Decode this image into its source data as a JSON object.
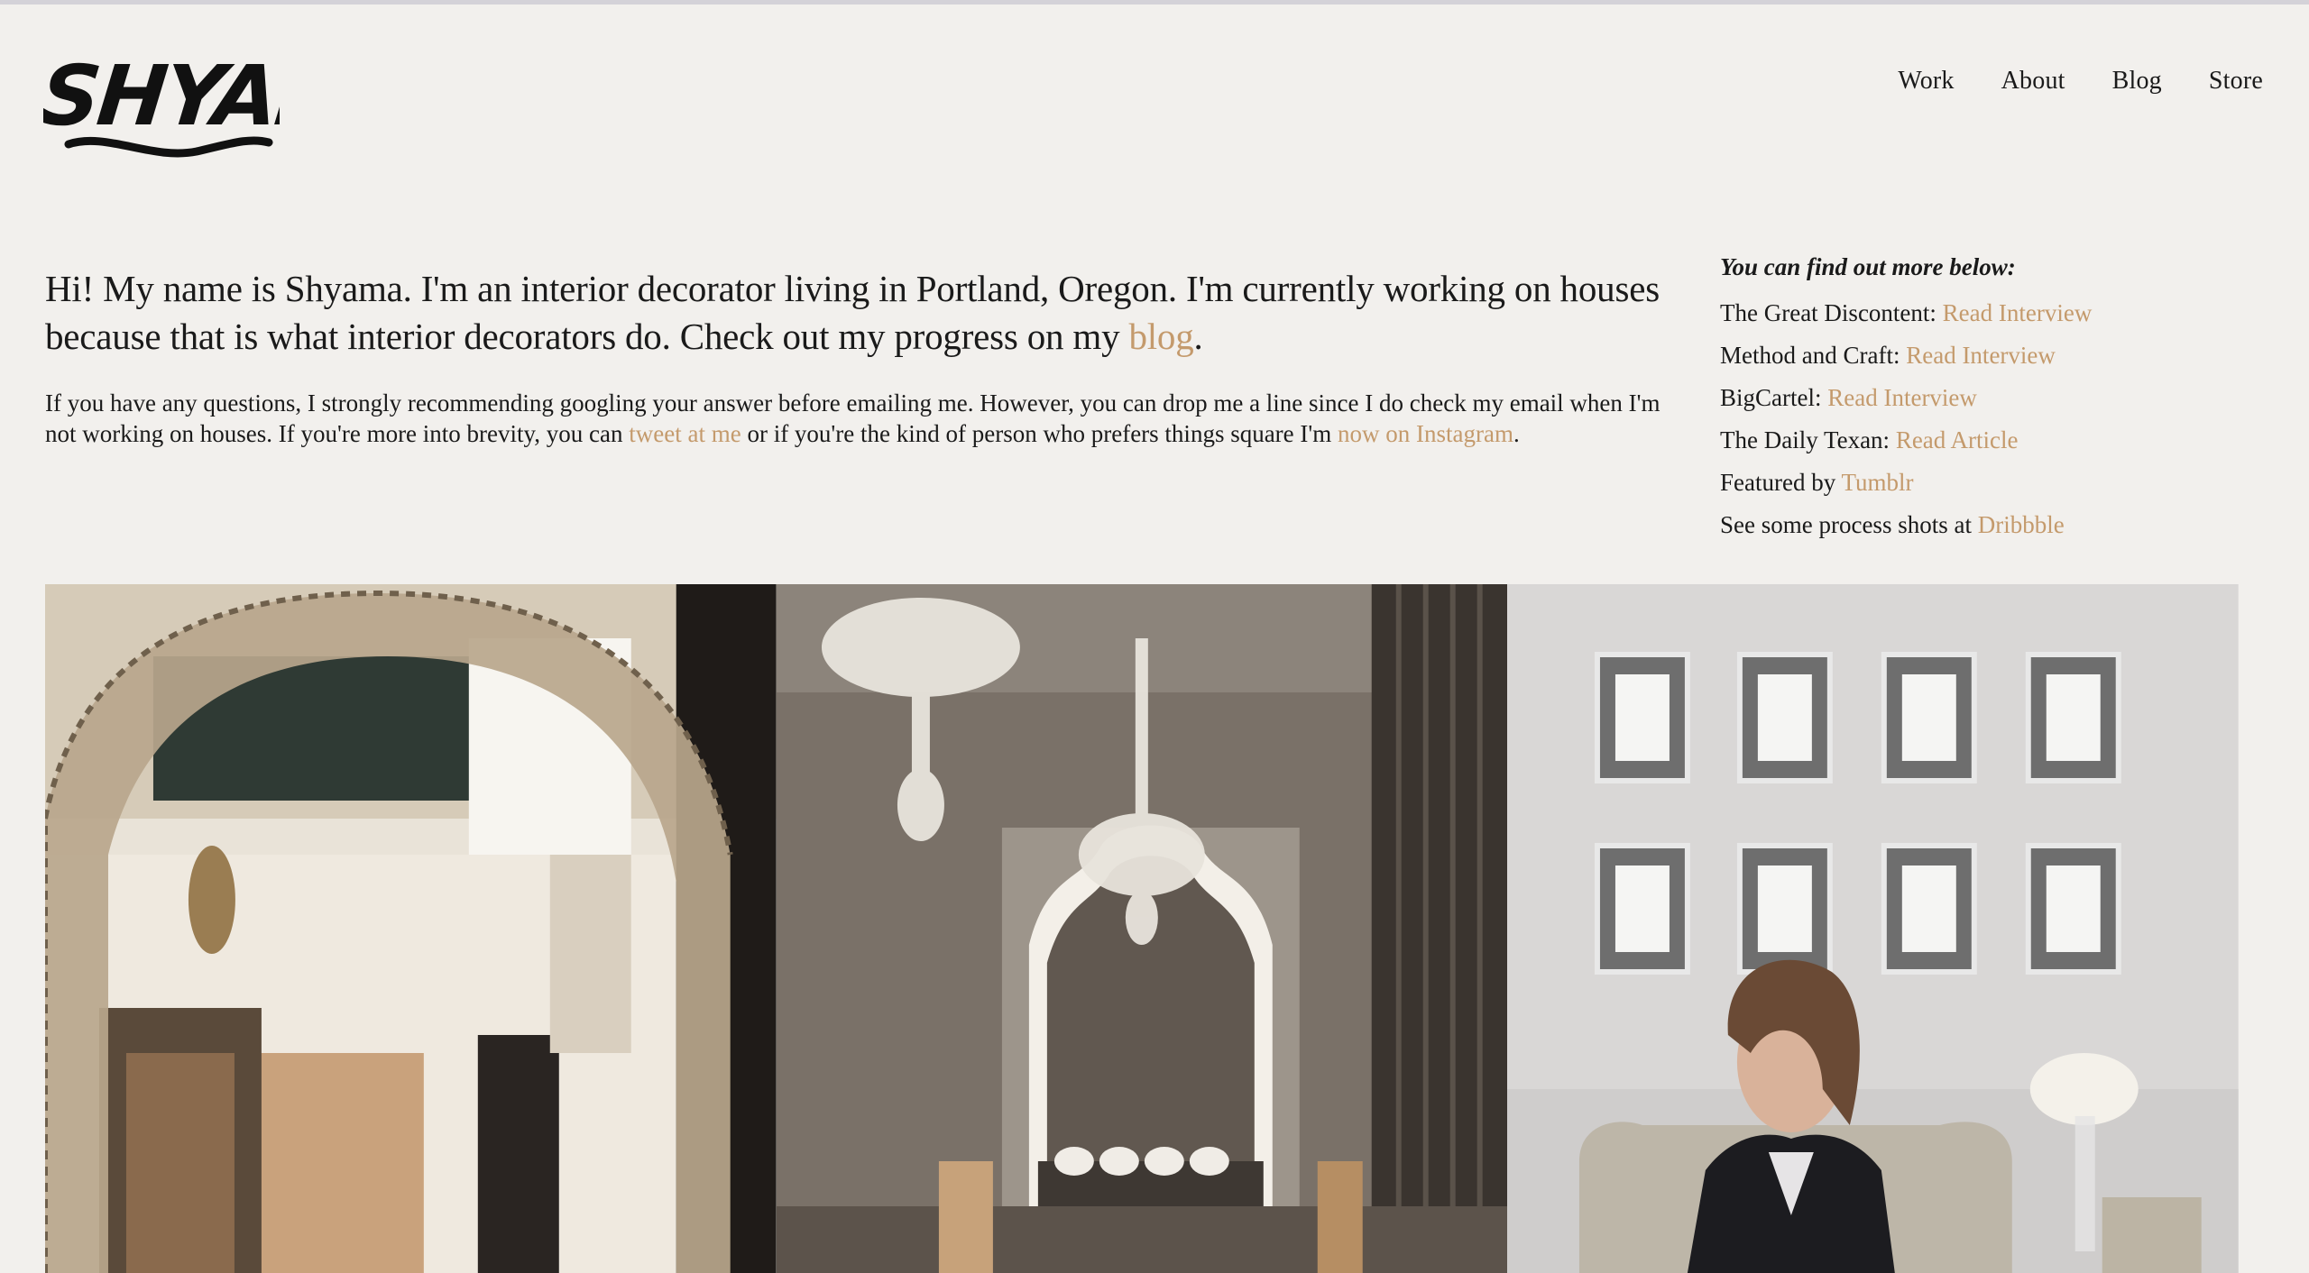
{
  "site": {
    "logo_text": "SHYAMA",
    "accent_color": "#c49a6c",
    "background_color": "#f2f0ed"
  },
  "nav": {
    "items": [
      {
        "label": "Work"
      },
      {
        "label": "About"
      },
      {
        "label": "Blog"
      },
      {
        "label": "Store"
      }
    ]
  },
  "intro": {
    "lead_text": "Hi! My name is Shyama. I'm an interior decorator living in Portland, Oregon. I'm currently working on houses because that is what interior decorators do. Check out my progress on my ",
    "lead_link": "blog",
    "lead_end": ".",
    "body_part1": "If you have any questions, I strongly recommending googling your answer before emailing me. However, you can drop me a line since I do check my email when I'm not working on houses. If you're more into brevity, you can ",
    "body_link1": "tweet at me",
    "body_part2": " or if you're the kind of person who prefers things square I'm ",
    "body_link2": "now on Instagram",
    "body_end": "."
  },
  "sidebar": {
    "title": "You can find out more below:",
    "rows": [
      {
        "text": "The Great Discontent: ",
        "link": "Read Interview"
      },
      {
        "text": "Method and Craft: ",
        "link": "Read Interview"
      },
      {
        "text": "BigCartel: ",
        "link": "Read Interview"
      },
      {
        "text": "The Daily Texan: ",
        "link": "Read Article"
      },
      {
        "text": "Featured by ",
        "link": "Tumblr"
      },
      {
        "text": "See some process shots at ",
        "link": "Dribbble"
      }
    ]
  },
  "gallery": {
    "images": [
      {
        "name": "moroccan-arch-interior-photo"
      },
      {
        "name": "chandelier-alcove-photo"
      },
      {
        "name": "portrait-with-frames-photo"
      }
    ]
  }
}
